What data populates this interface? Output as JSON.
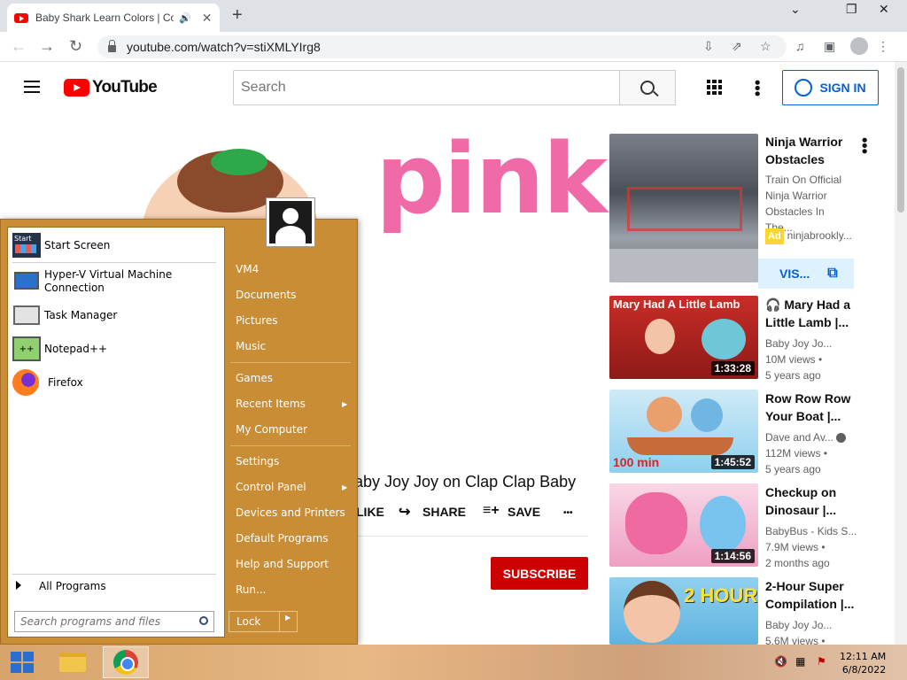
{
  "browser": {
    "tab_title": "Baby Shark Learn Colors | Co",
    "tab_close": "✕",
    "new_tab": "+",
    "url": "youtube.com/watch?v=stiXMLYIrg8",
    "win_min": "⌄",
    "win_restore": "❐",
    "win_close": "✕"
  },
  "youtube": {
    "logo_text": "YouTube",
    "search_placeholder": "Search",
    "sign_in": "SIGN IN",
    "video_word": "pink",
    "video_title": "aby Joy Joy on Clap Clap Baby",
    "video_title_prefix": "Baby",
    "actions": {
      "dislike": "LIKE",
      "share": "SHARE",
      "save": "SAVE",
      "more": "•••"
    },
    "subscribe": "SUBSCRIBE"
  },
  "sidebar": {
    "ad": {
      "title": "Ninja Warrior Obstacles",
      "desc": "Train On Official Ninja Warrior Obstacles In The...",
      "badge": "Ad",
      "channel": "ninjabrookly...",
      "visit": "VIS..."
    },
    "videos": [
      {
        "title": "🎧 Mary Had a Little Lamb |...",
        "channel": "Baby Joy Jo...",
        "views": "10M views •",
        "age": "5 years ago",
        "duration": "1:33:28",
        "thumb_text": "Mary Had A Little Lamb"
      },
      {
        "title": "Row Row Row Your Boat |...",
        "channel": "Dave and Av...",
        "views": "112M views •",
        "age": "5 years ago",
        "duration": "1:45:52",
        "thumb_text": "100 min"
      },
      {
        "title": "Checkup on Dinosaur |...",
        "channel": "BabyBus - Kids S...",
        "views": "7.9M views •",
        "age": "2 months ago",
        "duration": "1:14:56",
        "thumb_text": ""
      },
      {
        "title": "2-Hour Super Compilation |...",
        "channel": "Baby Joy Jo...",
        "views": "5.6M views •",
        "age": "",
        "duration": "",
        "thumb_text": "2 HOURS"
      }
    ]
  },
  "start_menu": {
    "programs": [
      {
        "label": "Start Screen",
        "icon": "start-screen-icon"
      },
      {
        "label": "Hyper-V Virtual Machine Connection",
        "icon": "hyperv-icon"
      },
      {
        "label": "Task Manager",
        "icon": "task-manager-icon"
      },
      {
        "label": "Notepad++",
        "icon": "notepadpp-icon"
      },
      {
        "label": "Firefox",
        "icon": "firefox-icon"
      }
    ],
    "all_programs": "All Programs",
    "search_placeholder": "Search programs and files",
    "right_items": [
      "VM4",
      "Documents",
      "Pictures",
      "Music",
      "Games",
      "Recent Items",
      "My Computer",
      "Settings",
      "Control Panel",
      "Devices and Printers",
      "Default Programs",
      "Help and Support",
      "Run..."
    ],
    "lock": "Lock"
  },
  "taskbar": {
    "time": "12:11 AM",
    "date": "6/8/2022"
  },
  "colors": {
    "start_menu": "#c98d35",
    "yt_red": "#ff0000",
    "signin_blue": "#065fd4"
  }
}
